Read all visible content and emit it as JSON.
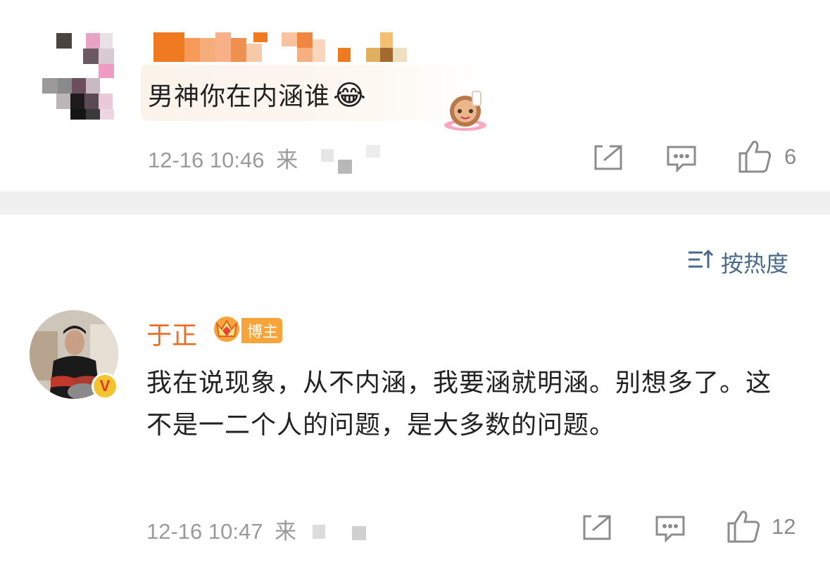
{
  "comment1": {
    "text": "男神你在内涵谁",
    "emoji": "😂",
    "time": "12-16 10:46",
    "from_prefix": "来",
    "likes": "6"
  },
  "sort": {
    "icon": "sort-icon",
    "label": "按热度"
  },
  "comment2": {
    "author": "于正",
    "badge_label": "博主",
    "verified_mark": "V",
    "text": "我在说现象，从不内涵，我要涵就明涵。别想多了。这不是一二个人的问题，是大多数的问题。",
    "time": "12-16 10:47",
    "from_prefix": "来",
    "likes": "12"
  },
  "colors": {
    "accent_orange": "#ee6d24",
    "sort_blue": "#4a6a8c",
    "meta_gray": "#9a9a9a",
    "divider": "#f0f0f0"
  }
}
